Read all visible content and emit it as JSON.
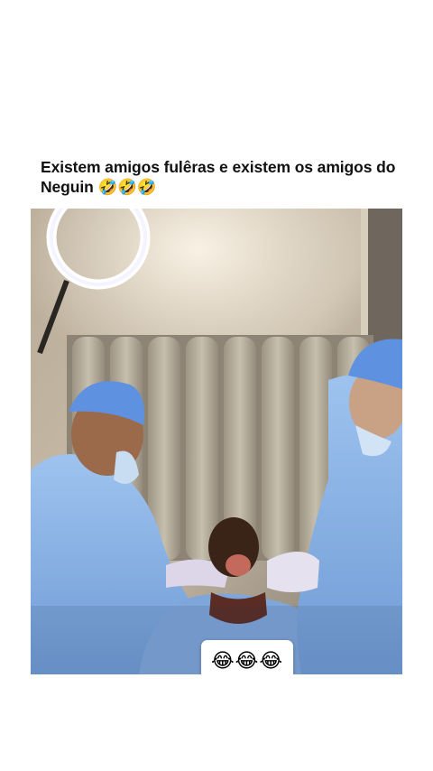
{
  "post": {
    "caption": "Existem amigos fulêras e existem os amigos do Neguin 🤣🤣🤣"
  },
  "media": {
    "overlay_sticker": "😂😂😂",
    "icons": [
      "ring-light",
      "surgical-cap",
      "face-mask",
      "patient"
    ]
  }
}
